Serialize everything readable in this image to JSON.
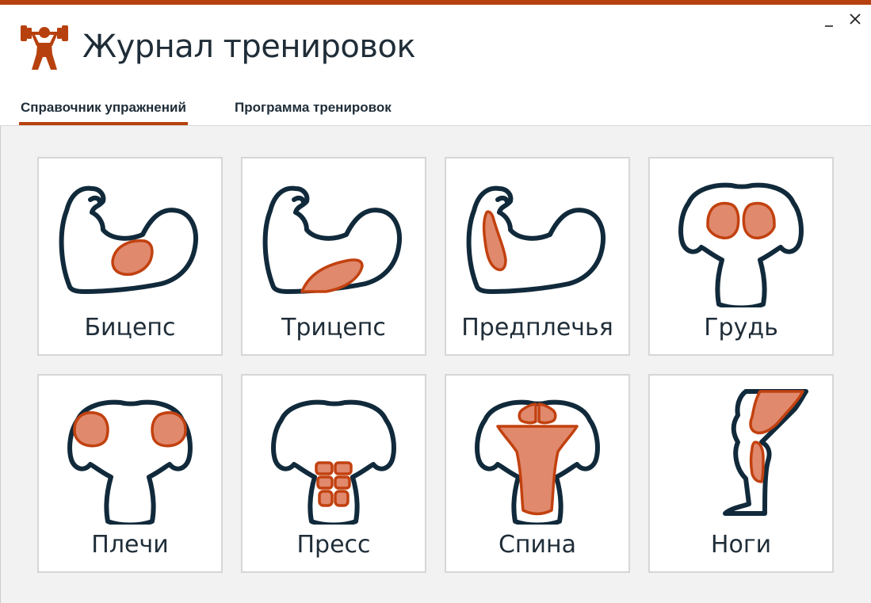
{
  "app": {
    "title": "Журнал тренировок"
  },
  "tabs": [
    {
      "label": "Справочник упражнений",
      "active": true
    },
    {
      "label": "Программа тренировок",
      "active": false
    }
  ],
  "window_controls": {
    "minimize": "−",
    "close": "×"
  },
  "muscle_groups": [
    {
      "label": "Бицепс"
    },
    {
      "label": "Трицепс"
    },
    {
      "label": "Предплечья"
    },
    {
      "label": "Грудь"
    },
    {
      "label": "Плечи"
    },
    {
      "label": "Пресс"
    },
    {
      "label": "Спина"
    },
    {
      "label": "Ноги"
    }
  ],
  "colors": {
    "accent": "#b7410e",
    "muscle_fill": "#e0896d",
    "outline": "#112a3b"
  }
}
